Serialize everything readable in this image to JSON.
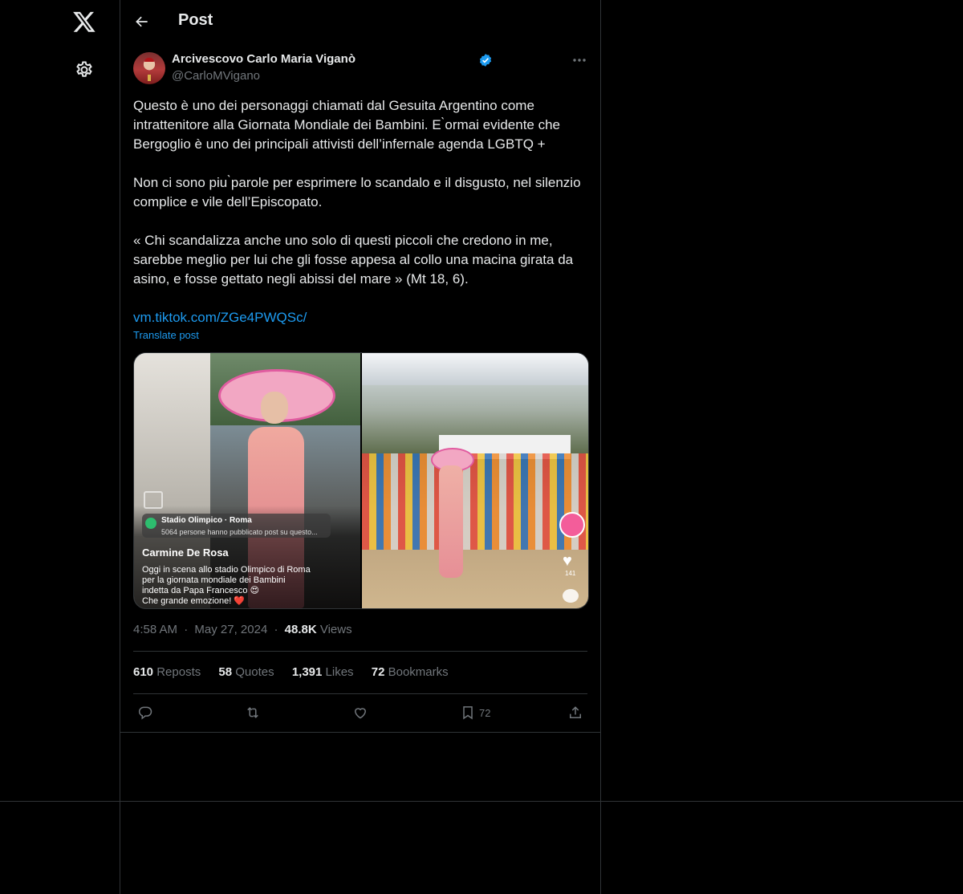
{
  "header": {
    "title": "Post"
  },
  "author": {
    "name": "Arcivescovo Carlo Maria Viganò",
    "handle": "@CarloMVigano"
  },
  "tweet": {
    "paragraphs": [
      "Questo è uno dei personaggi chiamati dal Gesuita Argentino come intrattenitore alla Giornata Mondiale dei Bambini. E ̀ormai evidente che Bergoglio è uno dei principali attivisti dell’infernale agenda LGBTQ +",
      "Non ci sono piu ̀parole per esprimere lo scandalo e il disgusto, nel silenzio complice e vile dell’Episcopato.",
      "« Chi scandalizza anche uno solo di questi piccoli che credono in me, sarebbe meglio per lui che gli fosse appesa al collo una macina girata da asino, e fosse gettato negli abissi del mare » (Mt 18, 6)."
    ],
    "link": "vm.tiktok.com/ZGe4PWQSc/",
    "translate": "Translate post"
  },
  "media": {
    "location_name": "Stadio Olimpico · Roma",
    "location_sub": "5064 persone hanno pubblicato post su questo...",
    "caption_author": "Carmine De Rosa",
    "caption_lines": [
      "Oggi in scena allo stadio Olimpico di Roma",
      "per la giornata mondiale dei Bambini",
      "indetta da Papa Francesco 😍",
      "Che grande emozione! ❤️"
    ],
    "like_count": "141"
  },
  "meta": {
    "time": "4:58 AM",
    "date": "May 27, 2024",
    "views_value": "48.8K",
    "views_label": "Views",
    "dot": "·"
  },
  "stats": {
    "reposts_value": "610",
    "reposts_label": "Reposts",
    "quotes_value": "58",
    "quotes_label": "Quotes",
    "likes_value": "1,391",
    "likes_label": "Likes",
    "bookmarks_value": "72",
    "bookmarks_label": "Bookmarks"
  },
  "actions": {
    "bookmark_count": "72"
  },
  "icons": [
    "x-logo-icon",
    "gear-icon",
    "back-arrow-icon",
    "verified-badge-icon",
    "more-icon",
    "reply-icon",
    "repost-icon",
    "like-icon",
    "bookmark-icon",
    "share-icon"
  ],
  "colors": {
    "background": "#000000",
    "text": "#e7e9ea",
    "muted": "#71767b",
    "accent": "#1d9bf0",
    "border": "#2f3336"
  }
}
